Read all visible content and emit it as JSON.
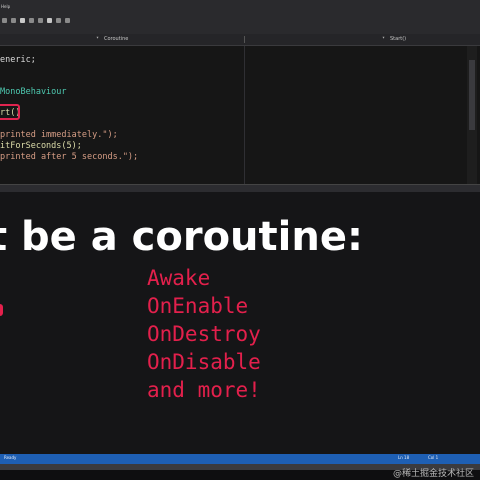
{
  "ide": {
    "menu_text": "Help",
    "tab_left": "Coroutine",
    "tab_right": "Start()"
  },
  "code": {
    "lines": [
      "eneric;",
      "",
      "MonoBehaviour",
      "",
      "rt()",
      "",
      "printed immediately.\");",
      "itForSeconds(5);",
      "printed after 5 seconds.\");"
    ]
  },
  "overlay": {
    "title": "t be a coroutine:",
    "methods": [
      "Awake",
      "OnEnable",
      "OnDestroy",
      "OnDisable",
      "and more!"
    ]
  },
  "status": {
    "left": "Ready",
    "ln": "Ln 18",
    "col": "Col 1"
  },
  "watermark": "@稀土掘金技术社区",
  "colors": {
    "accent_red": "#e3204c",
    "status_blue": "#1e5fb4",
    "editor_bg": "#161616"
  }
}
